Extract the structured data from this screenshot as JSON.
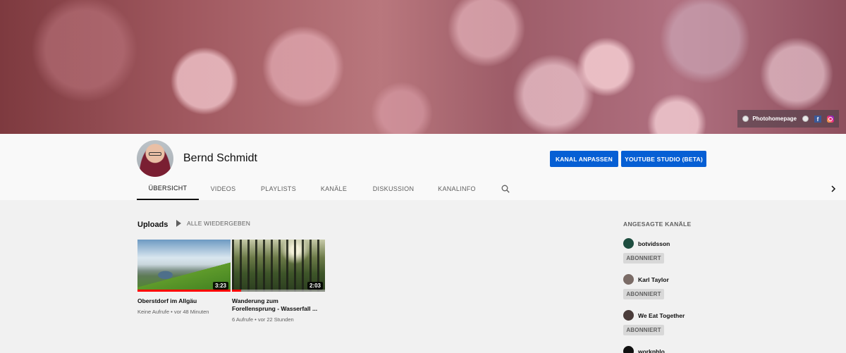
{
  "banner": {
    "links": [
      {
        "label": "Photohomepage",
        "icon": "globe-icon"
      },
      {
        "label": "",
        "icon": "globe-icon"
      },
      {
        "label": "",
        "icon": "facebook-icon"
      },
      {
        "label": "",
        "icon": "instagram-icon"
      }
    ]
  },
  "channel": {
    "name": "Bernd Schmidt",
    "customize_label": "KANAL ANPASSEN",
    "studio_label": "YOUTUBE STUDIO (BETA)"
  },
  "tabs": [
    {
      "label": "ÜBERSICHT",
      "active": true
    },
    {
      "label": "VIDEOS"
    },
    {
      "label": "PLAYLISTS"
    },
    {
      "label": "KANÄLE"
    },
    {
      "label": "DISKUSSION"
    },
    {
      "label": "KANALINFO"
    }
  ],
  "uploads": {
    "title": "Uploads",
    "play_all_label": "ALLE WIEDERGEBEN",
    "videos": [
      {
        "title": "Oberstdorf im Allgäu",
        "duration": "3:23",
        "meta": "Keine Aufrufe • vor 48 Minuten",
        "watched_fraction": 1.0
      },
      {
        "title": "Wanderung zum Forellensprung - Wasserfall ...",
        "duration": "2:03",
        "meta": "6 Aufrufe • vor 22 Stunden",
        "watched_fraction": 0.1
      }
    ]
  },
  "featured": {
    "title": "ANGESAGTE KANÄLE",
    "subscribed_label": "ABONNIERT",
    "channels": [
      {
        "name": "botvidsson",
        "avatar_color": "#1e4d3f"
      },
      {
        "name": "Karl Taylor",
        "avatar_color": "#7a6b66"
      },
      {
        "name": "We Eat Together",
        "avatar_color": "#4a3c3a"
      },
      {
        "name": "workphlo",
        "avatar_color": "#111111"
      }
    ]
  },
  "colors": {
    "accent": "#065fd4",
    "progress": "#ff0000"
  }
}
